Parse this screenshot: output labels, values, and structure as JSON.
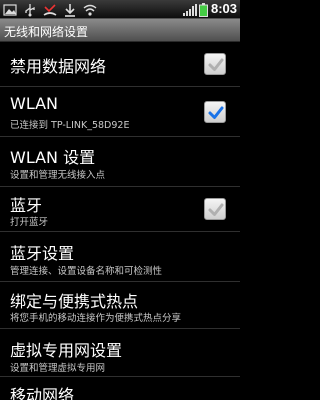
{
  "status_bar": {
    "time": "8:03",
    "icons": [
      "gallery-icon",
      "usb-icon",
      "missed-call-icon",
      "download-icon",
      "signal-icon",
      "battery-icon"
    ]
  },
  "title": "无线和网络设置",
  "items": [
    {
      "title": "禁用数据网络",
      "subtitle": "",
      "checkbox": "disabled-checked"
    },
    {
      "title": "WLAN",
      "subtitle": "已连接到 TP-LINK_58D92E",
      "checkbox": "checked"
    },
    {
      "title": "WLAN 设置",
      "subtitle": "设置和管理无线接入点",
      "checkbox": "none"
    },
    {
      "title": "蓝牙",
      "subtitle": "打开蓝牙",
      "checkbox": "disabled-checked"
    },
    {
      "title": "蓝牙设置",
      "subtitle": "管理连接、设置设备名称和可检测性",
      "checkbox": "none"
    },
    {
      "title": "绑定与便携式热点",
      "subtitle": "将您手机的移动连接作为便携式热点分享",
      "checkbox": "none"
    },
    {
      "title": "虚拟专用网设置",
      "subtitle": "设置和管理虚拟专用网",
      "checkbox": "none"
    },
    {
      "title": "移动网络",
      "subtitle": "",
      "checkbox": "none"
    }
  ],
  "colors": {
    "check_active": "#1a73e8",
    "check_disabled": "#b0b0b0"
  }
}
